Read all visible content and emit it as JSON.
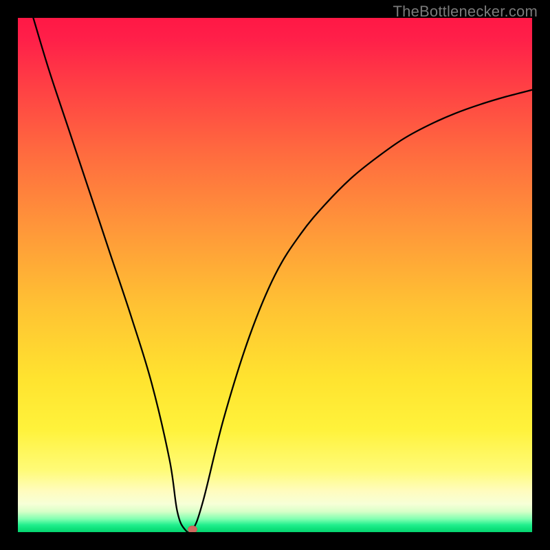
{
  "watermark": "TheBottlenecker.com",
  "chart_data": {
    "type": "line",
    "title": "",
    "xlabel": "",
    "ylabel": "",
    "xlim": [
      0,
      100
    ],
    "ylim": [
      0,
      100
    ],
    "grid": false,
    "legend": false,
    "series": [
      {
        "name": "bottleneck-curve",
        "x": [
          3,
          6,
          10,
          14,
          18,
          22,
          26,
          29.5,
          31,
          32.5,
          34,
          36,
          40,
          45,
          50,
          55,
          60,
          65,
          70,
          75,
          80,
          85,
          90,
          95,
          100
        ],
        "values": [
          100,
          90,
          78,
          66,
          54,
          42,
          29,
          14,
          4,
          0.5,
          0.5,
          6,
          22,
          38,
          50,
          58,
          64,
          69,
          73,
          76.5,
          79.2,
          81.4,
          83.2,
          84.7,
          86
        ]
      }
    ],
    "annotations": [
      {
        "name": "optimum-marker",
        "x": 34,
        "y": 0.5
      }
    ],
    "background_gradient_stops": [
      {
        "pos": 0,
        "color": "#ff1845"
      },
      {
        "pos": 40,
        "color": "#ff943a"
      },
      {
        "pos": 70,
        "color": "#ffe32f"
      },
      {
        "pos": 92,
        "color": "#fffcbe"
      },
      {
        "pos": 100,
        "color": "#06d46f"
      }
    ]
  }
}
